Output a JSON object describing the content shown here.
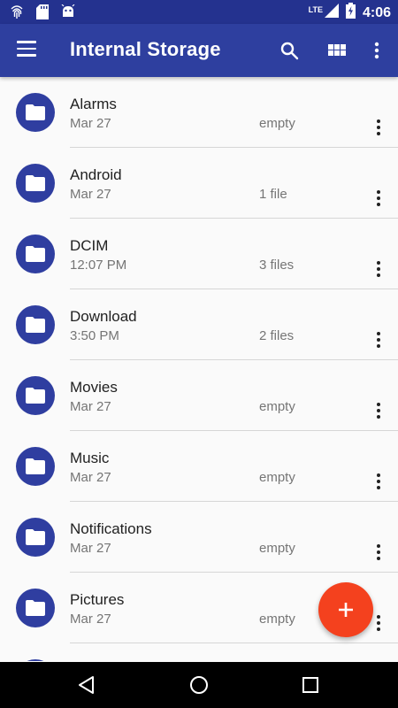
{
  "status_bar": {
    "time": "4:06",
    "network": "LTE",
    "icons": [
      "fingerprint-icon",
      "sd-card-icon",
      "android-icon",
      "signal-icon",
      "battery-charging-icon"
    ]
  },
  "app_bar": {
    "title": "Internal Storage",
    "icons": [
      "menu-icon",
      "search-icon",
      "grid-view-icon",
      "overflow-menu-icon"
    ]
  },
  "colors": {
    "primary": "#2e3f9f",
    "status_bar": "#24328f",
    "accent": "#f4411e",
    "folder": "#2f3ea0"
  },
  "folders": [
    {
      "name": "Alarms",
      "date": "Mar 27",
      "count": "empty"
    },
    {
      "name": "Android",
      "date": "Mar 27",
      "count": "1 file"
    },
    {
      "name": "DCIM",
      "date": "12:07 PM",
      "count": "3 files"
    },
    {
      "name": "Download",
      "date": "3:50 PM",
      "count": "2 files"
    },
    {
      "name": "Movies",
      "date": "Mar 27",
      "count": "empty"
    },
    {
      "name": "Music",
      "date": "Mar 27",
      "count": "empty"
    },
    {
      "name": "Notifications",
      "date": "Mar 27",
      "count": "empty"
    },
    {
      "name": "Pictures",
      "date": "Mar 27",
      "count": "empty"
    }
  ],
  "fab": {
    "icon": "plus-icon"
  },
  "nav_bar": {
    "icons": [
      "back-icon",
      "home-icon",
      "recents-icon"
    ]
  }
}
